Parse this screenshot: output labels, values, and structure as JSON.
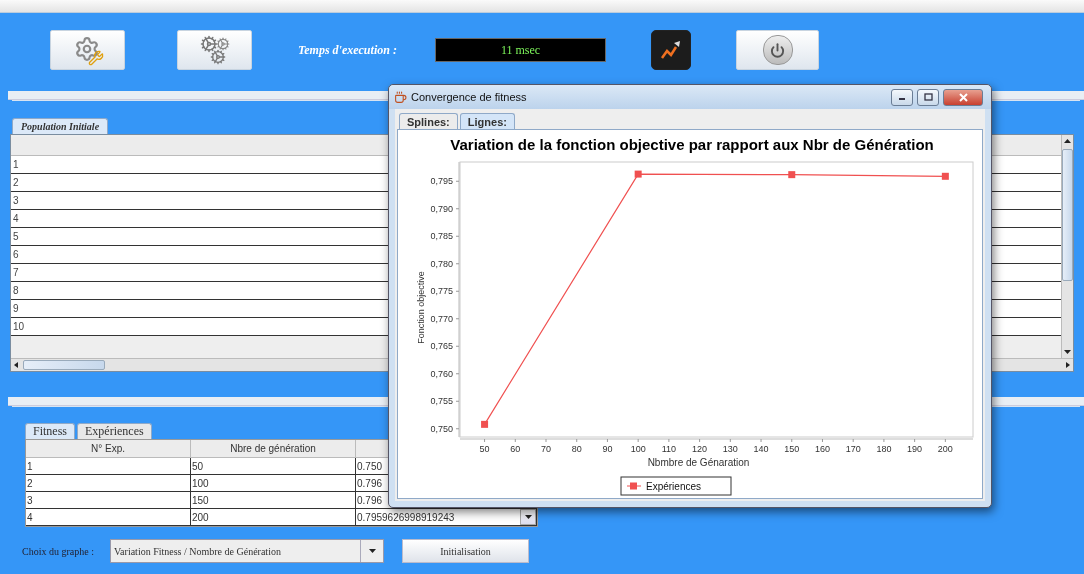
{
  "toolbar": {
    "execution_label": "Temps d'execution :",
    "execution_time": "11 msec"
  },
  "population": {
    "tabs": [
      {
        "label": "Population Initiale",
        "selected": true
      }
    ],
    "rows": [
      "1",
      "2",
      "3",
      "4",
      "5",
      "6",
      "7",
      "8",
      "9",
      "10"
    ]
  },
  "results": {
    "tabs": [
      {
        "label": "Fitness",
        "selected": true
      },
      {
        "label": "Expériences",
        "selected": false
      }
    ],
    "columns": [
      "N° Exp.",
      "Nbre de génération"
    ],
    "rows": [
      [
        "1",
        "50",
        "0.750"
      ],
      [
        "2",
        "100",
        "0.796"
      ],
      [
        "3",
        "150",
        "0.796"
      ],
      [
        "4",
        "200",
        "0.7959626998919243"
      ]
    ]
  },
  "graph_choice": {
    "label": "Choix du graphe :",
    "value": "Variation Fitness / Nombre de Génération"
  },
  "init_button": "Initialisation",
  "dialog": {
    "title": "Convergence de fitness",
    "tabs": [
      {
        "label": "Splines:",
        "selected": false
      },
      {
        "label": "Lignes:",
        "selected": true
      }
    ],
    "chart_data": {
      "type": "line",
      "title": "Variation de la fonction objective par rapport aux Nbr de Génération",
      "xlabel": "Nbmbre de Génaration",
      "ylabel": "Fonction objective",
      "x": [
        50,
        100,
        150,
        200
      ],
      "series": [
        {
          "name": "Expériences",
          "color": "#f05050",
          "marker": "square",
          "values": [
            0.7508,
            0.7963,
            0.7962,
            0.7959
          ]
        }
      ],
      "xlim": [
        42,
        209
      ],
      "ylim": [
        0.7485,
        0.7985
      ],
      "xticks": [
        50,
        60,
        70,
        80,
        90,
        100,
        110,
        120,
        130,
        140,
        150,
        160,
        170,
        180,
        190,
        200
      ],
      "yticks": [
        {
          "value": 0.75,
          "label": "0,750"
        },
        {
          "value": 0.755,
          "label": "0,755"
        },
        {
          "value": 0.76,
          "label": "0,760"
        },
        {
          "value": 0.765,
          "label": "0,765"
        },
        {
          "value": 0.77,
          "label": "0,770"
        },
        {
          "value": 0.775,
          "label": "0,775"
        },
        {
          "value": 0.78,
          "label": "0,780"
        },
        {
          "value": 0.785,
          "label": "0,785"
        },
        {
          "value": 0.79,
          "label": "0,790"
        },
        {
          "value": 0.795,
          "label": "0,795"
        }
      ]
    }
  }
}
